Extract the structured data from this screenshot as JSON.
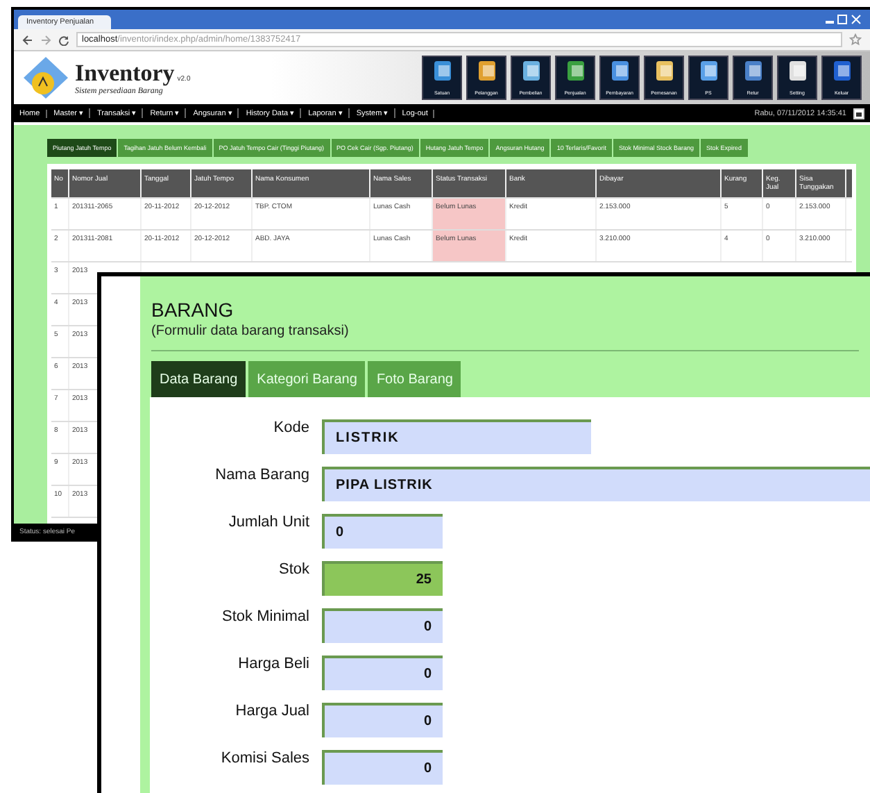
{
  "browser": {
    "tab_title": "Inventory Penjualan",
    "url_host": "localhost",
    "url_path": "/inventori/index.php/admin/home/1383752417"
  },
  "app": {
    "logo_title": "Inventory",
    "logo_version": "v2.0",
    "logo_subtitle": "Sistem persediaan Barang",
    "toolbar": [
      "Satuan",
      "Pelanggan",
      "Pembelian",
      "Penjualan",
      "Pembayaran",
      "Pemesanan",
      "PS",
      "Retur",
      "Setting",
      "Keluar"
    ],
    "menu": [
      "Home",
      "Master ▾",
      "Transaksi ▾",
      "Return ▾",
      "Angsuran ▾",
      "History Data ▾",
      "Laporan ▾",
      "System ▾",
      "Log-out"
    ],
    "datetime": "Rabu, 07/11/2012 14:35:41"
  },
  "tabs": [
    {
      "label": "Piutang Jatuh Tempo",
      "selected": true
    },
    {
      "label": "Tagihan Jatuh Belum Kembali",
      "selected": false
    },
    {
      "label": "PO Jatuh Tempo Cair (Tinggi Piutang)",
      "selected": false
    },
    {
      "label": "PO Cek Cair (Sgp. Piutang)",
      "selected": false
    },
    {
      "label": "Hutang Jatuh Tempo",
      "selected": false
    },
    {
      "label": "Angsuran Hutang",
      "selected": false
    },
    {
      "label": "10 Terlaris/Favorit",
      "selected": false
    },
    {
      "label": "Stok Minimal Stock Barang",
      "selected": false
    },
    {
      "label": "Stok Expired",
      "selected": false
    }
  ],
  "table": {
    "columns": [
      "No",
      "Nomor Jual",
      "Tanggal",
      "Jatuh Tempo",
      "Nama Konsumen",
      "Nama Sales",
      "Status Transaksi",
      "Bank",
      "Dibayar",
      "Kurang",
      "Keg. Jual",
      "Sisa Tunggakan"
    ],
    "rows": [
      {
        "cells": [
          "1",
          "201311-2065",
          "20-11-2012",
          "20-12-2012",
          "TBP. CTOM",
          "Lunas Cash",
          "Belum Lunas",
          "Kredit",
          "2.153.000",
          "5",
          "0",
          "2.153.000"
        ],
        "overdue": true
      },
      {
        "cells": [
          "2",
          "201311-2081",
          "20-11-2012",
          "20-12-2012",
          "ABD. JAYA",
          "Lunas Cash",
          "Belum Lunas",
          "Kredit",
          "3.210.000",
          "4",
          "0",
          "3.210.000"
        ],
        "overdue": true
      },
      {
        "cells": [
          "3",
          "2013"
        ]
      },
      {
        "cells": [
          "4",
          "2013"
        ]
      },
      {
        "cells": [
          "5",
          "2013"
        ]
      },
      {
        "cells": [
          "6",
          "2013"
        ]
      },
      {
        "cells": [
          "7",
          "2013"
        ]
      },
      {
        "cells": [
          "8",
          "2013"
        ]
      },
      {
        "cells": [
          "9",
          "2013"
        ]
      },
      {
        "cells": [
          "10",
          "2013"
        ]
      }
    ]
  },
  "status_bar": "Status: selesai Pe",
  "form": {
    "title": "BARANG",
    "subtitle": "(Formulir data barang transaksi)",
    "tabs": [
      {
        "label": "Data Barang",
        "selected": true
      },
      {
        "label": "Kategori Barang",
        "selected": false
      },
      {
        "label": "Foto Barang",
        "selected": false
      }
    ],
    "fields": [
      {
        "label": "Kode",
        "value": "LISTRIK",
        "kind": "code",
        "highlighted": false
      },
      {
        "label": "Nama Barang",
        "value": "PIPA LISTRIK",
        "kind": "name",
        "highlighted": false
      },
      {
        "label": "Jumlah Unit",
        "value": "0",
        "kind": "count",
        "highlighted": false
      },
      {
        "label": "Stok",
        "value": "25",
        "kind": "amount",
        "highlighted": true
      },
      {
        "label": "Stok Minimal",
        "value": "0",
        "kind": "amount",
        "highlighted": false
      },
      {
        "label": "Harga Beli",
        "value": "0",
        "kind": "amount",
        "highlighted": false
      },
      {
        "label": "Harga Jual",
        "value": "0",
        "kind": "amount",
        "highlighted": false
      },
      {
        "label": "Komisi Sales",
        "value": "0",
        "kind": "amount",
        "highlighted": false
      }
    ]
  }
}
